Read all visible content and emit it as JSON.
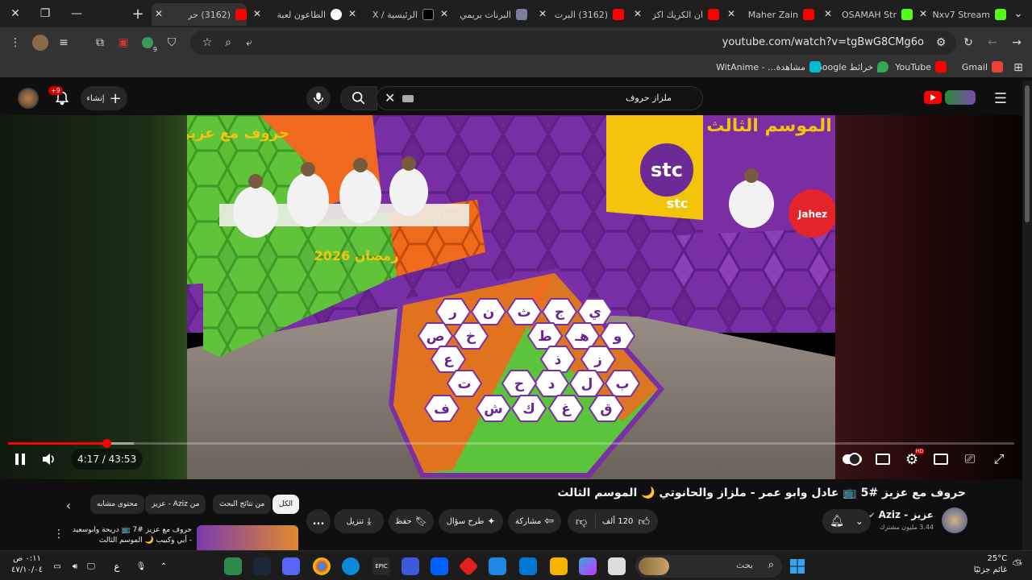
{
  "browser": {
    "tabs": [
      {
        "title": "Nxv7 Stream",
        "fav_color": "#53fc18"
      },
      {
        "title": "OSAMAH Str",
        "fav_color": "#53fc18"
      },
      {
        "title": "Maher Zain",
        "fav_color": "#ff0000"
      },
      {
        "title": "ان الكريك اكز",
        "fav_color": "#ff0000"
      },
      {
        "title": "(3162) البرت",
        "fav_color": "#ff0000"
      },
      {
        "title": "البرنات بريمي",
        "fav_color": "#7c7c9c"
      },
      {
        "title": "الرئيسية / X",
        "fav_color": "#000000"
      },
      {
        "title": "الطاعون لعبة",
        "fav_color": "#ffffff"
      },
      {
        "title": "(3162) حر",
        "fav_color": "#ff0000"
      }
    ],
    "url": "youtube.com/watch?v=tgBwG8CMg6o",
    "bookmarks": [
      {
        "label": "Gmail",
        "color": "#ea4335"
      },
      {
        "label": "YouTube",
        "color": "#ff0000"
      },
      {
        "label": "خرائط Google",
        "color": "#34a853"
      },
      {
        "label": "مشاهدة... - WitAnime",
        "color": "#00bcd4"
      }
    ],
    "extension_badge": "9"
  },
  "youtube": {
    "search_query": "ملزاز حروف",
    "create_label": "إنشاء",
    "notif_badge": "+9"
  },
  "player": {
    "time": "4:17 / 43:53",
    "progress_fraction": 0.098,
    "buffer_fraction": 0.125,
    "hd_badge": "HD",
    "board_letters": [
      "ي",
      "ج",
      "ث",
      "ن",
      "ر",
      "و",
      "هـ",
      "ط",
      "خ",
      "ص",
      "ز",
      "ذ",
      "ع",
      "ب",
      "ل",
      "د",
      "ح",
      "ت",
      "ق",
      "غ",
      "ك",
      "ش",
      "ف"
    ],
    "frame_text": {
      "stc1": "stc",
      "stc2": "stc",
      "jahez": "Jahez",
      "season": "الموسم الثالث",
      "show_logo": "حروف مع عزيز",
      "ramadan": "رمضان 2026"
    }
  },
  "video": {
    "title": "حروف مع عزيز #5 📺 عادل وابو عمر - ملزاز والحانوتي 🌙 الموسم الثالث",
    "channel": "عزيز - Aziz",
    "subscribers": "3.44 مليون مشترك",
    "likes": "120 ألف",
    "share": "مشاركة",
    "ask": "طرح سؤال",
    "save": "حفظ",
    "download": "تنزيل",
    "more": "..."
  },
  "chips": [
    "الكل",
    "من نتائج البحث",
    "من Aziz - عزيز",
    "محتوى مشابه"
  ],
  "related": {
    "title": "حروف مع عزيز #7 📺 دريحة وابوسعيد - أبي وكبيب 🌙 الموسم الثالث"
  },
  "taskbar": {
    "search_placeholder": "بحث",
    "weather_temp": "25°C",
    "weather_desc": "غائم جزئيًا",
    "time": "٠:١١ ص",
    "date": "٤٧/١٠/٠٤",
    "lang": "ع"
  }
}
